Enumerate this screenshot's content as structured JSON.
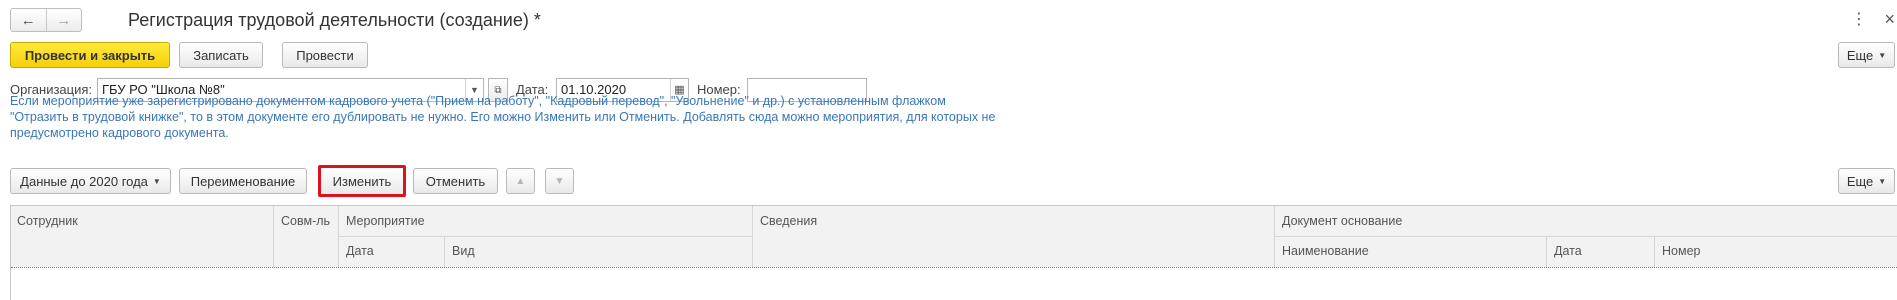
{
  "window": {
    "title": "Регистрация трудовой деятельности (создание) *",
    "back_icon": "←",
    "forward_icon": "→",
    "more_icon": "⋮",
    "close_icon": "×"
  },
  "toolbar": {
    "post_close_label": "Провести и закрыть",
    "save_label": "Записать",
    "post_label": "Провести",
    "more_label": "Еще"
  },
  "form": {
    "org_label": "Организация:",
    "org_value": "ГБУ РО \"Школа №8\"",
    "date_label": "Дата:",
    "date_value": "01.10.2020",
    "number_label": "Номер:",
    "number_value": ""
  },
  "info_text": "Если мероприятие уже зарегистрировано документом кадрового учета (\"Прием на работу\", \"Кадровый перевод\", \"Увольнение\" и др.) с установленным флажком \"Отразить в трудовой книжке\", то в этом документе его дублировать не нужно. Его можно Изменить или Отменить. Добавлять сюда можно мероприятия, для которых не предусмотрено кадрового документа.",
  "table_toolbar": {
    "data_before_label": "Данные до 2020 года",
    "rename_label": "Переименование",
    "change_label": "Изменить",
    "cancel_label": "Отменить",
    "more_label": "Еще",
    "highlight_color": "#e0101c"
  },
  "table": {
    "headers": {
      "employee": "Сотрудник",
      "part_time": "Совм-ль",
      "event": "Мероприятие",
      "event_date": "Дата",
      "event_type": "Вид",
      "info": "Сведения",
      "basis_doc": "Документ основание",
      "basis_name": "Наименование",
      "basis_date": "Дата",
      "basis_number": "Номер"
    }
  },
  "colors": {
    "primary_button": "#f5cf0a",
    "info_text": "#3a77b6"
  }
}
